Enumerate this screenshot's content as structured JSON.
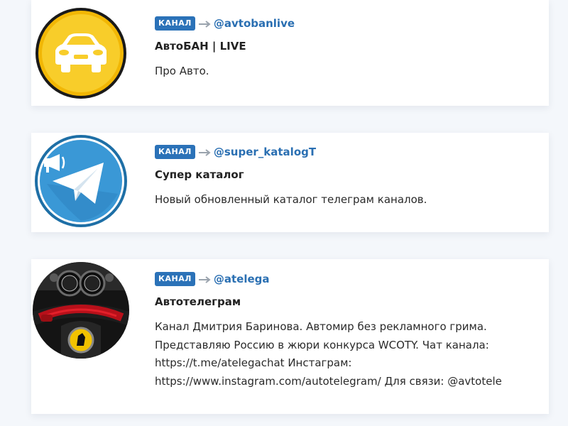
{
  "channels": [
    {
      "badge": "КАНАЛ",
      "handle": "@avtobanlive",
      "title": "АвтоБАН | LIVE",
      "description": "Про Авто.",
      "avatar_icon": "car-icon",
      "colors": {
        "avatar_bg": "#f5c518",
        "avatar_ring": "#1a1a1a"
      }
    },
    {
      "badge": "КАНАЛ",
      "handle": "@super_katalogT",
      "title": "Супер каталог",
      "description": "Новый обновленный каталог телеграм каналов.",
      "avatar_icon": "telegram-megaphone-icon",
      "colors": {
        "avatar_bg": "#2f8fcf"
      }
    },
    {
      "badge": "КАНАЛ",
      "handle": "@atelega",
      "title": "Автотелеграм",
      "description_lines": [
        "Канал Дмитрия Баринова. Автомир без рекламного грима.",
        "Представляю Россию в жюри конкурса WCOTY. Чат канала:",
        "https://t.me/atelegachat Инстаграм:",
        "https://www.instagram.com/autotelegram/ Для связи: @avtotele"
      ],
      "avatar_icon": "steering-wheel-photo",
      "colors": {
        "avatar_bg": "#1c1c1c",
        "accent": "#c0141c"
      }
    }
  ],
  "colors": {
    "badge_bg": "#2b72b8",
    "handle": "#2a6fb2",
    "page_bg": "#f4f7fb"
  }
}
